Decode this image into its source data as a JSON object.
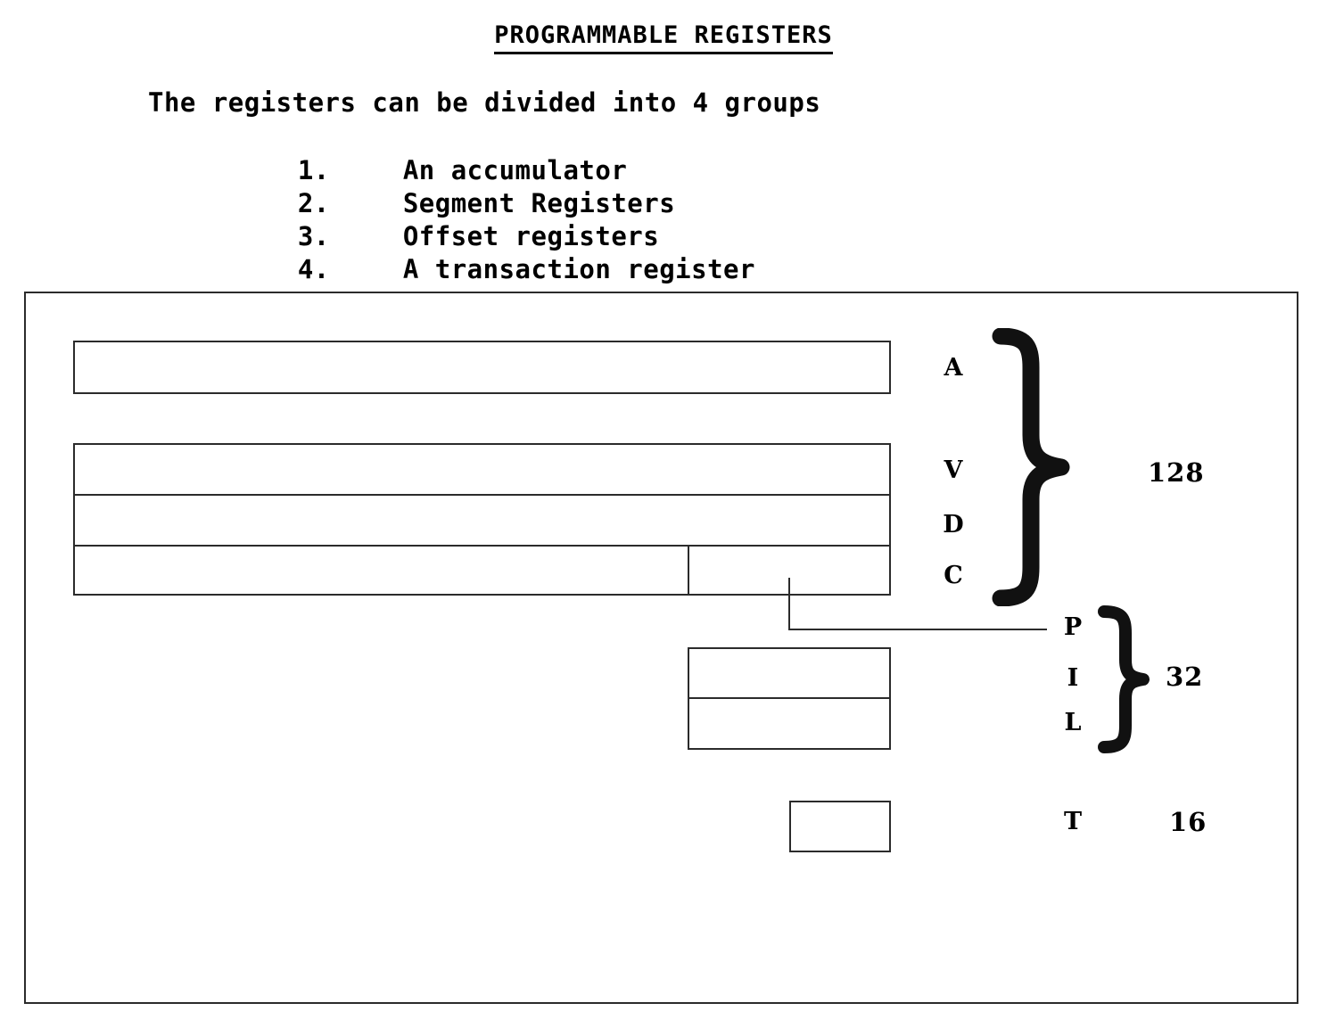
{
  "page": {
    "title": "PROGRAMMABLE REGISTERS",
    "intro": "The registers can be divided into 4 groups",
    "groups": [
      {
        "num": "1.",
        "label": "An accumulator"
      },
      {
        "num": "2.",
        "label": "Segment Registers"
      },
      {
        "num": "3.",
        "label": "Offset registers"
      },
      {
        "num": "4.",
        "label": "A transaction register"
      }
    ]
  },
  "diagram": {
    "registers": [
      {
        "label": "A",
        "group": "accumulator"
      },
      {
        "label": "V",
        "group": "segment"
      },
      {
        "label": "D",
        "group": "segment"
      },
      {
        "label": "C",
        "group": "segment"
      },
      {
        "label": "P",
        "group": "offset"
      },
      {
        "label": "I",
        "group": "offset"
      },
      {
        "label": "L",
        "group": "offset"
      },
      {
        "label": "T",
        "group": "transaction"
      }
    ],
    "sizes": {
      "accumulator_segment_bits": "128",
      "offset_bits": "32",
      "transaction_bits": "16"
    },
    "colors": {
      "line": "#2b2b2b",
      "background": "#ffffff",
      "text": "#000000"
    }
  }
}
